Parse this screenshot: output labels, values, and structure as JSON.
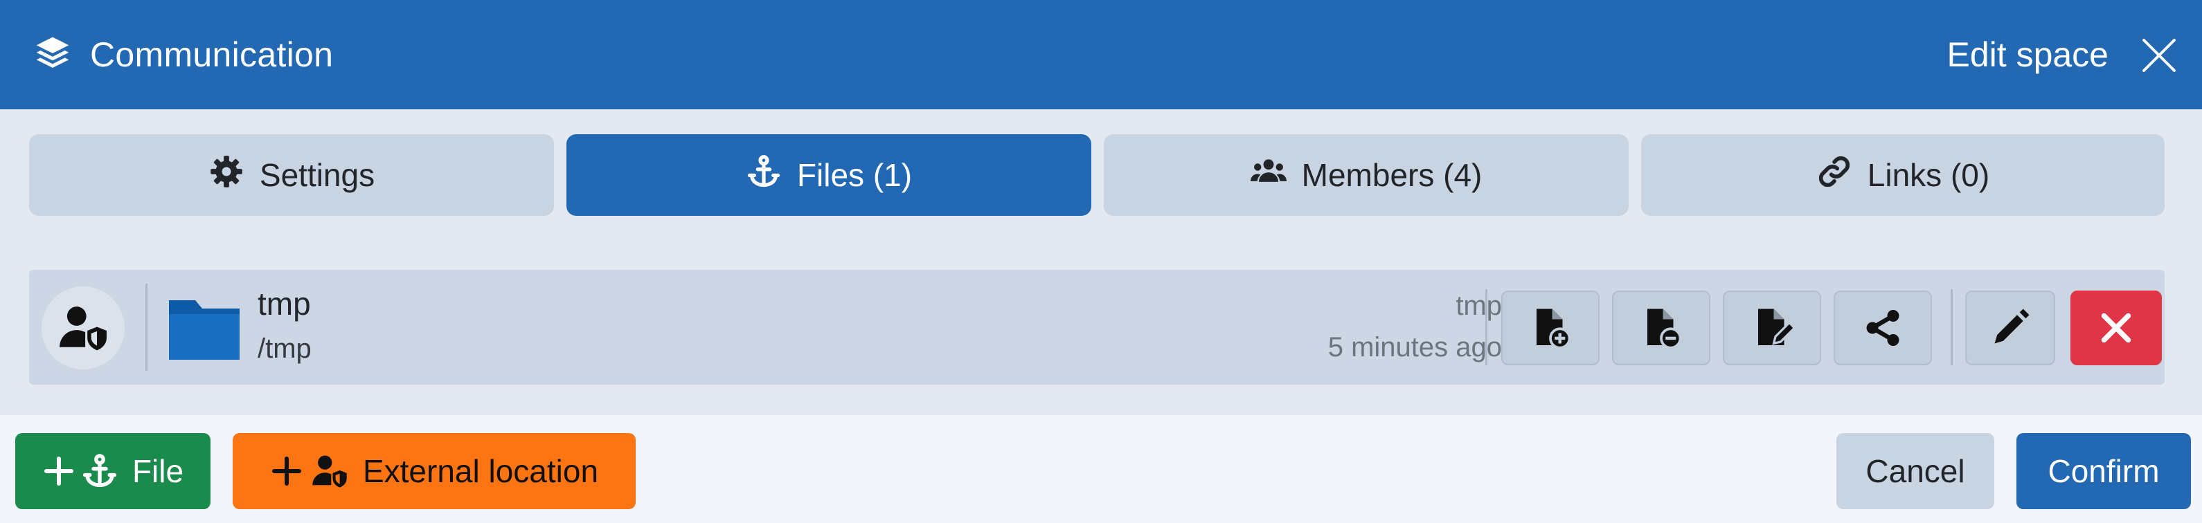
{
  "header": {
    "title": "Communication",
    "title_icon": "layers-icon",
    "edit_label": "Edit space",
    "close_icon": "close-icon"
  },
  "tabs": [
    {
      "label": "Settings",
      "icon": "gear-icon",
      "active": false
    },
    {
      "label": "Files (1)",
      "icon": "anchor-icon",
      "active": true
    },
    {
      "label": "Members (4)",
      "icon": "users-icon",
      "active": false
    },
    {
      "label": "Links (0)",
      "icon": "link-icon",
      "active": false
    }
  ],
  "file": {
    "name": "tmp",
    "path": "/tmp",
    "owner": "tmp",
    "time": "5 minutes ago",
    "avatar_icon": "user-shield-icon",
    "folder_icon": "folder-icon",
    "actions": [
      "file-add-icon",
      "file-remove-icon",
      "file-edit-icon",
      "share-icon",
      "pencil-icon",
      "delete-x-icon"
    ]
  },
  "footer": {
    "add_file_label": "File",
    "external_label": "External location",
    "cancel_label": "Cancel",
    "confirm_label": "Confirm"
  },
  "colors": {
    "primary": "#2268b2",
    "success": "#1b8a4d",
    "warning": "#fd7413",
    "danger": "#e03546",
    "secondary": "#c9d4e3"
  }
}
